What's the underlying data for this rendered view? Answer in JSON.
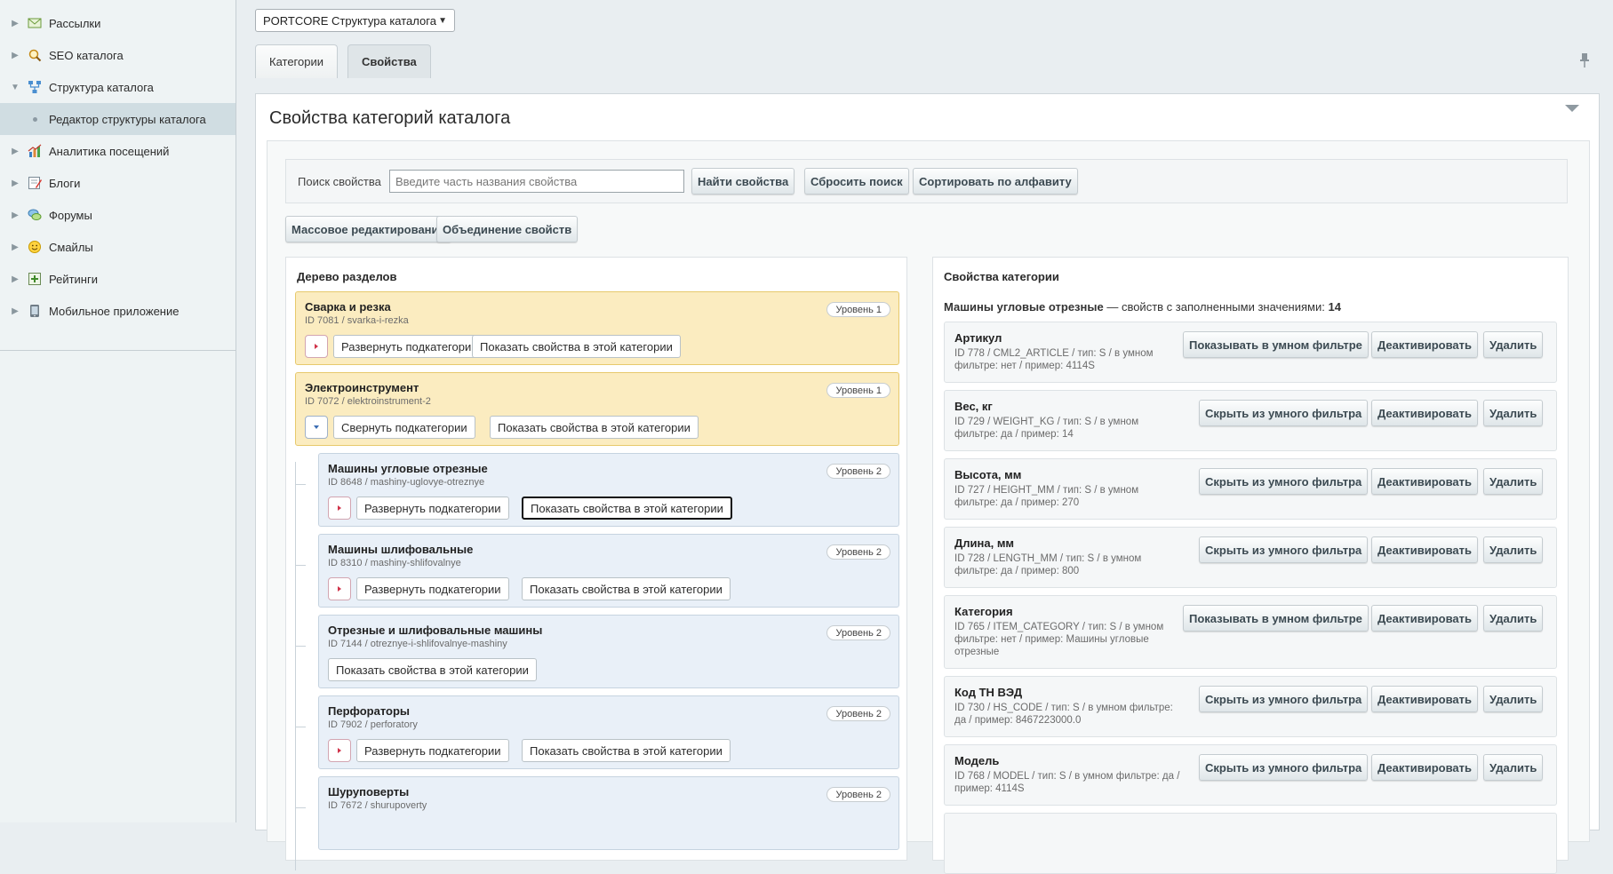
{
  "sidebar": {
    "items": [
      {
        "label": "Рассылки",
        "icon": "mail-icon",
        "arrow": "▶"
      },
      {
        "label": "SEO каталога",
        "icon": "seo-search-icon",
        "arrow": "▶"
      },
      {
        "label": "Структура каталога",
        "icon": "structure-icon",
        "arrow": "▼"
      },
      {
        "label": "Редактор структуры каталога",
        "sub": true
      },
      {
        "label": "Аналитика посещений",
        "icon": "analytics-icon",
        "arrow": "▶"
      },
      {
        "label": "Блоги",
        "icon": "blog-icon",
        "arrow": "▶"
      },
      {
        "label": "Форумы",
        "icon": "forum-icon",
        "arrow": "▶"
      },
      {
        "label": "Смайлы",
        "icon": "smiley-icon",
        "arrow": "▶"
      },
      {
        "label": "Рейтинги",
        "icon": "rating-icon",
        "arrow": "▶"
      },
      {
        "label": "Мобильное приложение",
        "icon": "mobile-icon",
        "arrow": "▶"
      }
    ]
  },
  "header": {
    "site_select": "PORTCORE Структура каталога",
    "tabs": [
      {
        "label": "Категории"
      },
      {
        "label": "Свойства"
      }
    ]
  },
  "main": {
    "title": "Свойства категорий каталога",
    "search": {
      "label": "Поиск свойства",
      "placeholder": "Введите часть названия свойства",
      "value": "",
      "find_button": "Найти свойства",
      "reset_button": "Сбросить поиск",
      "sort_button": "Сортировать по алфавиту"
    },
    "mass_edit_button": "Массовое редактирование",
    "merge_button": "Объединение свойств"
  },
  "tree": {
    "title": "Дерево разделов",
    "nodes": [
      {
        "title": "Сварка и резка",
        "id": "ID 7081 / svarka-i-rezka",
        "level": "Уровень 1",
        "toggle_btn": "Развернуть подкатегории",
        "show_btn": "Показать свойства в этой категории"
      },
      {
        "title": "Электроинструмент",
        "id": "ID 7072 / elektroinstrument-2",
        "level": "Уровень 1",
        "toggle_btn": "Свернуть подкатегории",
        "show_btn": "Показать свойства в этой категории"
      },
      {
        "title": "Машины угловые отрезные",
        "id": "ID 8648 / mashiny-uglovye-otreznye",
        "level": "Уровень 2",
        "toggle_btn": "Развернуть подкатегории",
        "show_btn": "Показать свойства в этой категории"
      },
      {
        "title": "Машины шлифовальные",
        "id": "ID 8310 / mashiny-shlifovalnye",
        "level": "Уровень 2",
        "toggle_btn": "Развернуть подкатегории",
        "show_btn": "Показать свойства в этой категории"
      },
      {
        "title": "Отрезные и шлифовальные машины",
        "id": "ID 7144 / otreznye-i-shlifovalnye-mashiny",
        "level": "Уровень 2",
        "show_btn": "Показать свойства в этой категории"
      },
      {
        "title": "Перфораторы",
        "id": "ID 7902 / perforatory",
        "level": "Уровень 2",
        "toggle_btn": "Развернуть подкатегории",
        "show_btn": "Показать свойства в этой категории"
      },
      {
        "title": "Шуруповерты",
        "id": "ID 7672 / shurupoverty",
        "level": "Уровень 2"
      }
    ]
  },
  "props": {
    "title": "Свойства категории",
    "summary_category": "Машины угловые отрезные",
    "summary_text": "— свойств с заполненными значениями:",
    "summary_count": "14",
    "deactivate_label": "Деактивировать",
    "delete_label": "Удалить",
    "items": [
      {
        "name": "Артикул",
        "meta": "ID 778 / CML2_ARTICLE / тип: S / в умном фильтре: нет / пример: 4114S",
        "filter_btn": "Показывать в умном фильтре"
      },
      {
        "name": "Вес, кг",
        "meta": "ID 729 / WEIGHT_KG / тип: S / в умном фильтре: да / пример: 14",
        "filter_btn": "Скрыть из умного фильтра"
      },
      {
        "name": "Высота, мм",
        "meta": "ID 727 / HEIGHT_MM / тип: S / в умном фильтре: да / пример: 270",
        "filter_btn": "Скрыть из умного фильтра"
      },
      {
        "name": "Длина, мм",
        "meta": "ID 728 / LENGTH_MM / тип: S / в умном фильтре: да / пример: 800",
        "filter_btn": "Скрыть из умного фильтра"
      },
      {
        "name": "Категория",
        "meta": "ID 765 / ITEM_CATEGORY / тип: S / в умном фильтре: нет / пример: Машины угловые отрезные",
        "filter_btn": "Показывать в умном фильтре"
      },
      {
        "name": "Код ТН ВЭД",
        "meta": "ID 730 / HS_CODE / тип: S / в умном фильтре: да / пример: 8467223000.0",
        "filter_btn": "Скрыть из умного фильтра"
      },
      {
        "name": "Модель",
        "meta": "ID 768 / MODEL / тип: S / в умном фильтре: да / пример: 4114S",
        "filter_btn": "Скрыть из умного фильтра"
      }
    ]
  },
  "colors": {
    "level1_bg": "#fbecc0",
    "level2_bg": "#e9f0f8",
    "sidebar_active": "#d0dde2"
  }
}
